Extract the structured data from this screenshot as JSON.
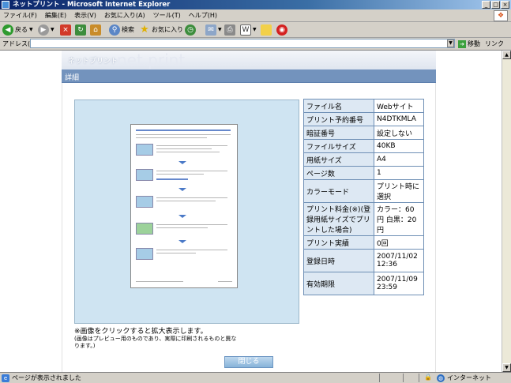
{
  "window": {
    "title": "ネットプリント - Microsoft Internet Explorer"
  },
  "menu": [
    "ファイル(F)",
    "編集(E)",
    "表示(V)",
    "お気に入り(A)",
    "ツール(T)",
    "ヘルプ(H)"
  ],
  "toolbar": {
    "back": "戻る",
    "search": "検索",
    "favorites": "お気に入り"
  },
  "address": {
    "label": "アドレス(D)",
    "value": "",
    "go": "移動",
    "links": "リンク"
  },
  "site": {
    "brand_jp": "ネットプリント",
    "brand_en": "net print",
    "section": "詳細"
  },
  "details": [
    {
      "label": "ファイル名",
      "value": "Webサイト"
    },
    {
      "label": "プリント予約番号",
      "value": "N4DTKMLA"
    },
    {
      "label": "暗証番号",
      "value": "設定しない"
    },
    {
      "label": "ファイルサイズ",
      "value": "40KB"
    },
    {
      "label": "用紙サイズ",
      "value": "A4"
    },
    {
      "label": "ページ数",
      "value": "1"
    },
    {
      "label": "カラーモード",
      "value": "プリント時に選択"
    },
    {
      "label": "プリント料金(※)(登録用紙サイズでプリントした場合)",
      "value": "カラー：60円 白黒：20円"
    },
    {
      "label": "プリント実績",
      "value": "0回"
    },
    {
      "label": "登録日時",
      "value": "2007/11/02 12:36"
    },
    {
      "label": "有効期限",
      "value": "2007/11/09 23:59"
    }
  ],
  "preview": {
    "note": "※画像をクリックすると拡大表示します。",
    "subnote": "(画像はプレビュー用のものであり、実際に印刷されるものと異なります。)"
  },
  "close_label": "閉じる",
  "status": {
    "message": "ページが表示されました",
    "zone": "インターネット"
  }
}
